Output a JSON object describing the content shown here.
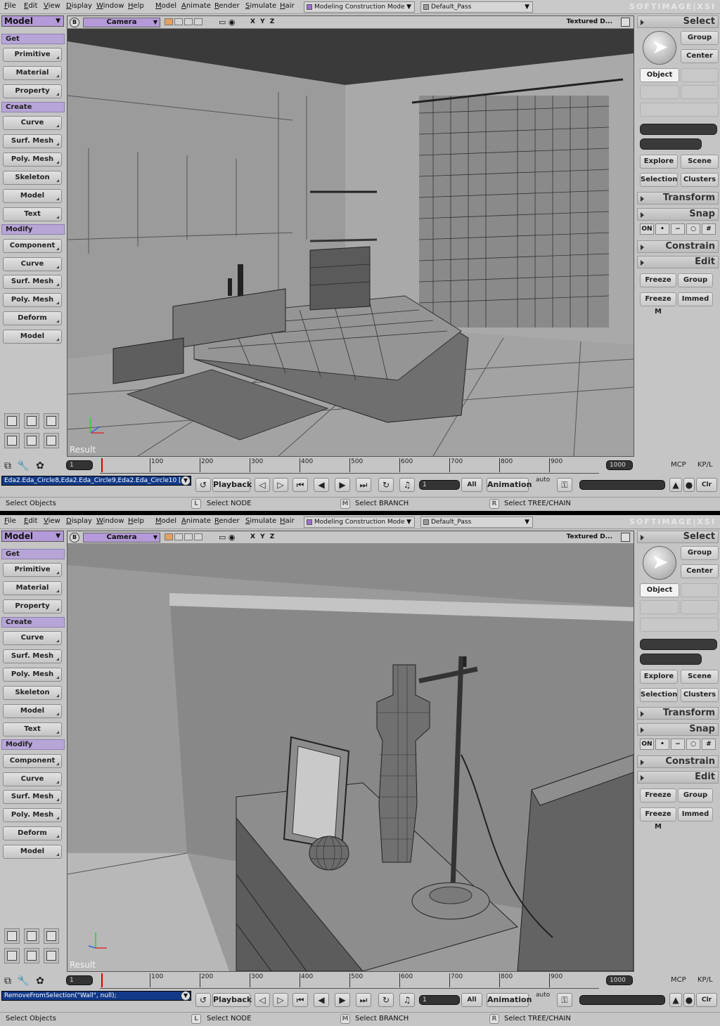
{
  "menubar": {
    "items": [
      "File",
      "Edit",
      "View",
      "Display",
      "Window",
      "Help",
      "Model",
      "Animate",
      "Render",
      "Simulate",
      "Hair"
    ],
    "mode_dropdown": "Modeling Construction Mode",
    "pass_dropdown": "Default_Pass",
    "brand": "SOFTIMAGE|XSI"
  },
  "left_panel": {
    "module": "Model",
    "sections": {
      "get": "Get",
      "create": "Create",
      "modify": "Modify"
    },
    "get_buttons": [
      "Primitive",
      "Material",
      "Property"
    ],
    "create_buttons": [
      "Curve",
      "Surf. Mesh",
      "Poly. Mesh",
      "Skeleton",
      "Model",
      "Text"
    ],
    "modify_buttons": [
      "Component",
      "Curve",
      "Surf. Mesh",
      "Poly. Mesh",
      "Deform",
      "Model"
    ]
  },
  "viewport": {
    "view_button": "B",
    "camera": "Camera",
    "axes": "X Y Z",
    "shading": "Textured D...",
    "result_label": "Result"
  },
  "right_panel": {
    "select_title": "Select",
    "group": "Group",
    "center": "Center",
    "object": "Object",
    "explore": "Explore",
    "scene": "Scene",
    "selection": "Selection",
    "clusters": "Clusters",
    "transform": "Transform",
    "snap": "Snap",
    "snap_on": "ON",
    "constrain": "Constrain",
    "edit": "Edit",
    "freeze": "Freeze",
    "edit_group": "Group",
    "freeze_m": "Freeze M",
    "immed": "Immed"
  },
  "timeline": {
    "start_frame": "1",
    "end_frame": "1000",
    "ticks": [
      "100",
      "200",
      "300",
      "400",
      "500",
      "600",
      "700",
      "800",
      "900"
    ],
    "mcp": "MCP",
    "kpl": "KP/L"
  },
  "playback": {
    "playback_label": "Playback",
    "current_frame": "1",
    "all_label": "All",
    "animation_label": "Animation",
    "auto_label": "auto",
    "clr_label": "Clr"
  },
  "status": {
    "select_objects": "Select Objects",
    "l_hint": "Select NODE",
    "m_hint": "Select BRANCH",
    "r_hint": "Select TREE/CHAIN",
    "l_key": "L",
    "m_key": "M",
    "r_key": "R"
  },
  "panels": [
    {
      "command_line": "Eda2.Eda_Circle8,Eda2.Eda_Circle9,Eda2.Eda_Circle10 [...]"
    },
    {
      "command_line": "RemoveFromSelection(\"Wall\", null);"
    }
  ],
  "colors": {
    "ui_bg": "#c5c5c5",
    "purple_accent": "#b49ad8",
    "command_bg": "#123a88",
    "timeline_cursor": "#dd0000"
  }
}
